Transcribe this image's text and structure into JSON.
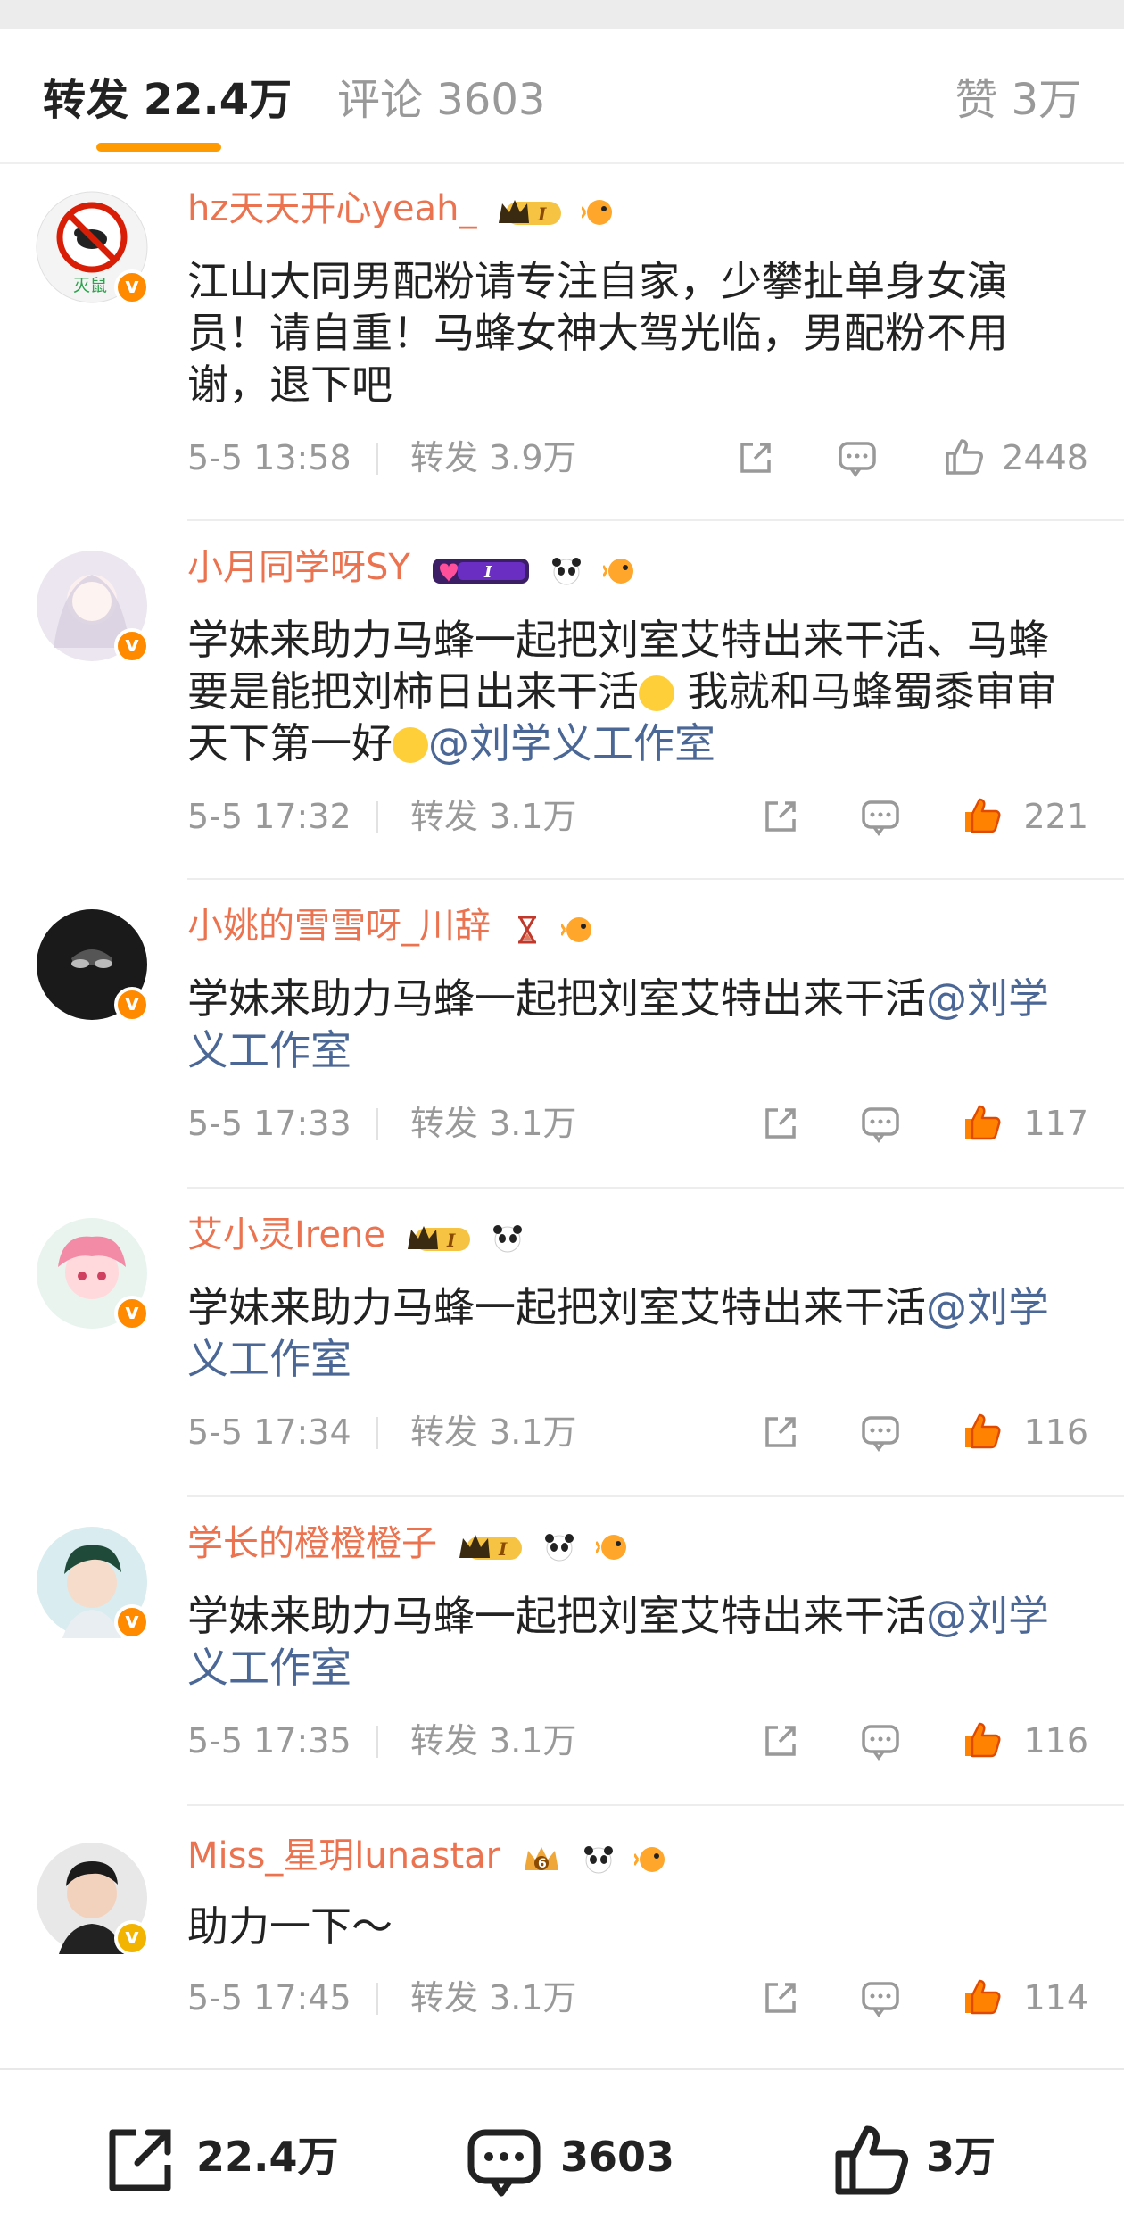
{
  "tabs": {
    "reposts": "转发 22.4万",
    "comments": "评论 3603",
    "likes": "赞 3万"
  },
  "comments": [
    {
      "user": "hz天天开心yeah_",
      "avatar_text": "灭鼠",
      "text": "江山大同男配粉请专注自家，少攀扯单身女演员！请自重！马蜂女神大驾光临，男配粉不用谢，退下吧",
      "date": "5-5 13:58",
      "repost": "转发 3.9万",
      "likes": "2448",
      "liked": false
    },
    {
      "user": "小月同学呀SY",
      "text_part1": "学妹来助力马蜂一起把刘室艾特出来干活、马蜂要是能把刘柿日出来干活",
      "text_part2": " 我就和马蜂蜀黍审审天下第一好",
      "mention": "@刘学义工作室",
      "date": "5-5 17:32",
      "repost": "转发 3.1万",
      "likes": "221",
      "liked": true
    },
    {
      "user": "小姚的雪雪呀_川辞",
      "text": "学妹来助力马蜂一起把刘室艾特出来干活",
      "mention": "@刘学义工作室",
      "date": "5-5 17:33",
      "repost": "转发 3.1万",
      "likes": "117",
      "liked": true
    },
    {
      "user": "艾小灵Irene",
      "text": "学妹来助力马蜂一起把刘室艾特出来干活",
      "mention": "@刘学义工作室",
      "date": "5-5 17:34",
      "repost": "转发 3.1万",
      "likes": "116",
      "liked": true
    },
    {
      "user": "学长的橙橙橙子",
      "text": "学妹来助力马蜂一起把刘室艾特出来干活",
      "mention": "@刘学义工作室",
      "date": "5-5 17:35",
      "repost": "转发 3.1万",
      "likes": "116",
      "liked": true
    },
    {
      "user": "Miss_星玥lunastar",
      "text": "助力一下～",
      "date": "5-5 17:45",
      "repost": "转发 3.1万",
      "likes": "114",
      "liked": true
    }
  ],
  "bottom_bar": {
    "share_count": "22.4万",
    "comment_count": "3603",
    "like_count": "3万"
  },
  "colors": {
    "username": "#eb7350",
    "mention": "#4a6796",
    "accent": "#ff9a00",
    "liked": "#ff8200"
  }
}
